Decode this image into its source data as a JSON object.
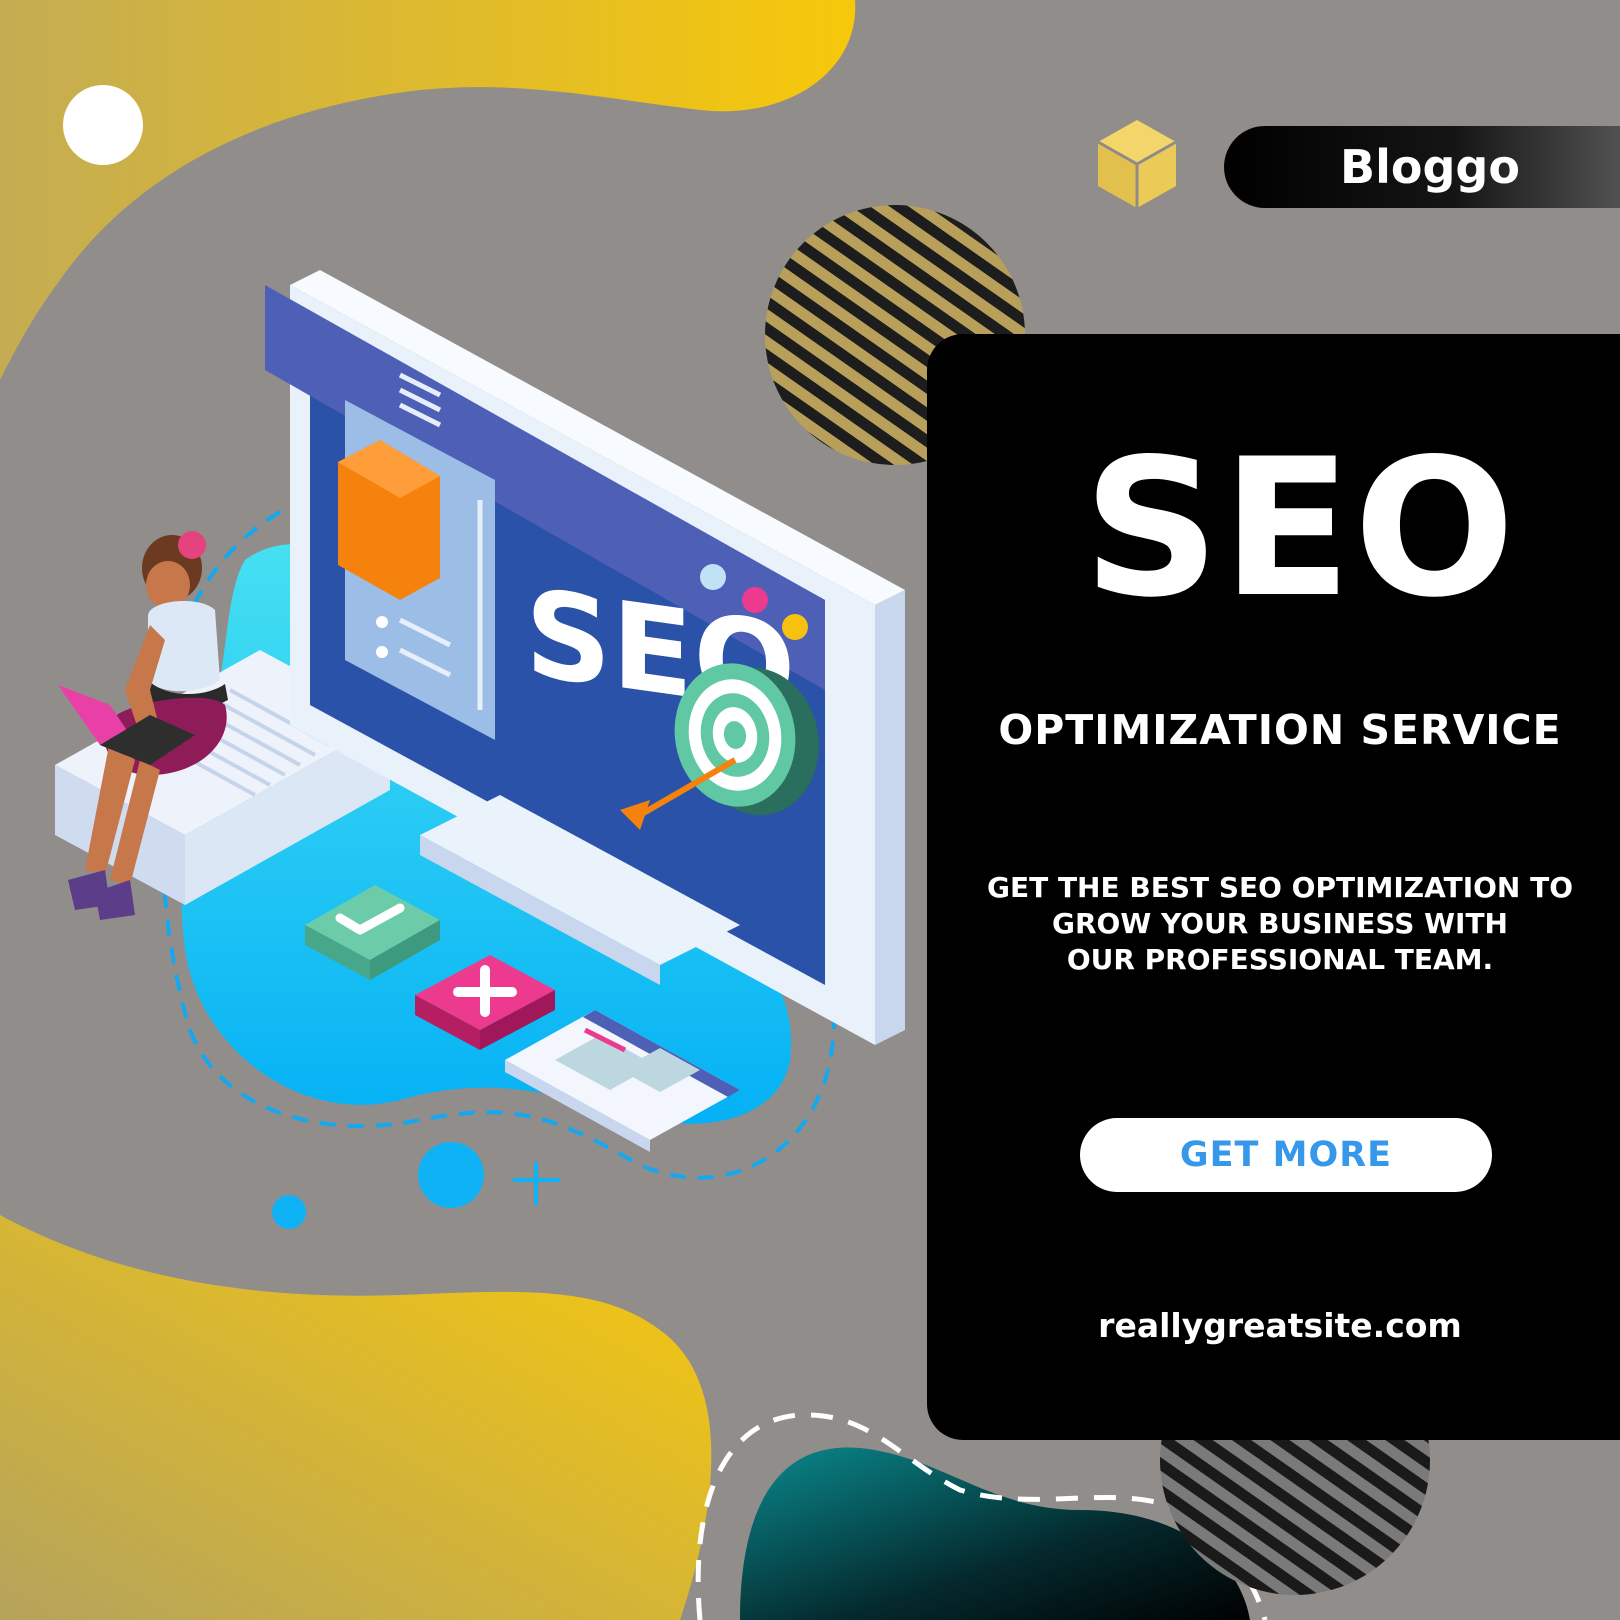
{
  "brand": {
    "name": "Bloggo",
    "logo_icon": "cube-icon"
  },
  "hero": {
    "title": "SEO",
    "subtitle": "OPTIMIZATION SERVICE",
    "description": "GET THE BEST SEO OPTIMIZATION TO\nGROW YOUR BUSINESS WITH\nOUR PROFESSIONAL TEAM.",
    "cta_label": "GET MORE",
    "website": "reallygreatsite.com"
  },
  "illustration": {
    "screen_text": "SEO",
    "code_badge": "</>",
    "icons": [
      "code-icon",
      "target-icon",
      "checkmark-icon",
      "plus-icon",
      "document-icon"
    ]
  },
  "colors": {
    "background": "#918d8b",
    "yellow_blob": "#f5c20d",
    "panel": "#000000",
    "cta_text": "#3598ea",
    "accent_blue": "#0ab6f3"
  }
}
